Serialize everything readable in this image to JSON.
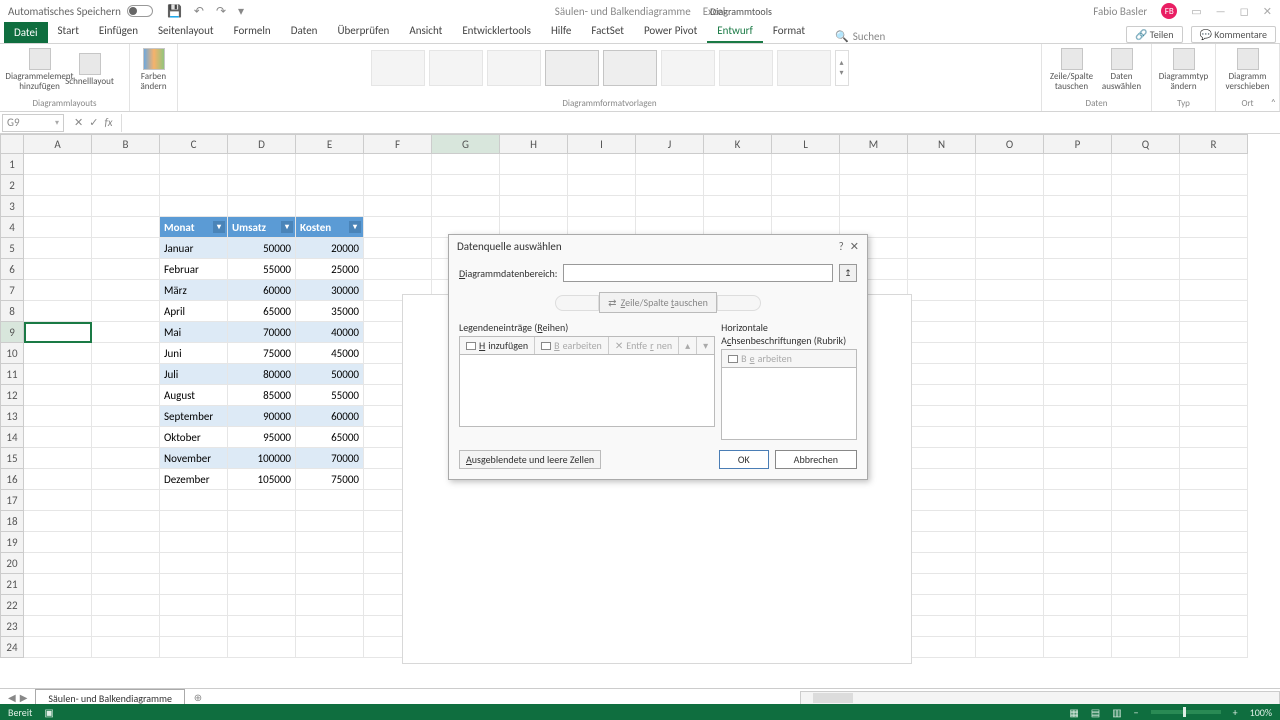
{
  "titlebar": {
    "autosave": "Automatisches Speichern",
    "doc_name": "Säulen- und Balkendiagramme",
    "app_name": "Excel",
    "tools_context": "Diagrammtools",
    "user": "Fabio Basler",
    "avatar": "FB"
  },
  "tabs": {
    "file": "Datei",
    "list": [
      "Start",
      "Einfügen",
      "Seitenlayout",
      "Formeln",
      "Daten",
      "Überprüfen",
      "Ansicht",
      "Entwicklertools",
      "Hilfe",
      "FactSet",
      "Power Pivot",
      "Entwurf",
      "Format"
    ],
    "active": "Entwurf",
    "search": "Suchen",
    "share": "Teilen",
    "comments": "Kommentare"
  },
  "ribbon": {
    "groups": {
      "layouts": "Diagrammlayouts",
      "layouts_b1": "Diagrammelement hinzufügen",
      "layouts_b2": "Schnelllayout",
      "colors": "Farben ändern",
      "styles": "Diagrammformatvorlagen",
      "data": "Daten",
      "data_b1": "Zeile/Spalte tauschen",
      "data_b2": "Daten auswählen",
      "type": "Typ",
      "type_b1": "Diagrammtyp ändern",
      "loc": "Ort",
      "loc_b1": "Diagramm verschieben"
    }
  },
  "namebox": "G9",
  "columns": [
    "A",
    "B",
    "C",
    "D",
    "E",
    "F",
    "G",
    "H",
    "I",
    "J",
    "K",
    "L",
    "M",
    "N",
    "O",
    "P",
    "Q",
    "R"
  ],
  "table": {
    "headers": [
      "Monat",
      "Umsatz",
      "Kosten"
    ],
    "rows": [
      [
        "Januar",
        "50000",
        "20000"
      ],
      [
        "Februar",
        "55000",
        "25000"
      ],
      [
        "März",
        "60000",
        "30000"
      ],
      [
        "April",
        "65000",
        "35000"
      ],
      [
        "Mai",
        "70000",
        "40000"
      ],
      [
        "Juni",
        "75000",
        "45000"
      ],
      [
        "Juli",
        "80000",
        "50000"
      ],
      [
        "August",
        "85000",
        "55000"
      ],
      [
        "September",
        "90000",
        "60000"
      ],
      [
        "Oktober",
        "95000",
        "65000"
      ],
      [
        "November",
        "100000",
        "70000"
      ],
      [
        "Dezember",
        "105000",
        "75000"
      ]
    ]
  },
  "dialog": {
    "title": "Datenquelle auswählen",
    "range_label": "Diagrammdatenbereich:",
    "swap": "Zeile/Spalte tauschen",
    "left_label": "Legendeneinträge (Reihen)",
    "right_label": "Horizontale Achsenbeschriftungen (Rubrik)",
    "add": "Hinzufügen",
    "edit": "Bearbeiten",
    "remove": "Entfernen",
    "edit2": "Bearbeiten",
    "hidden": "Ausgeblendete und leere Zellen",
    "ok": "OK",
    "cancel": "Abbrechen"
  },
  "sheet": {
    "tab1": "Säulen- und Balkendiagramme"
  },
  "status": {
    "ready": "Bereit",
    "zoom": "100%"
  }
}
